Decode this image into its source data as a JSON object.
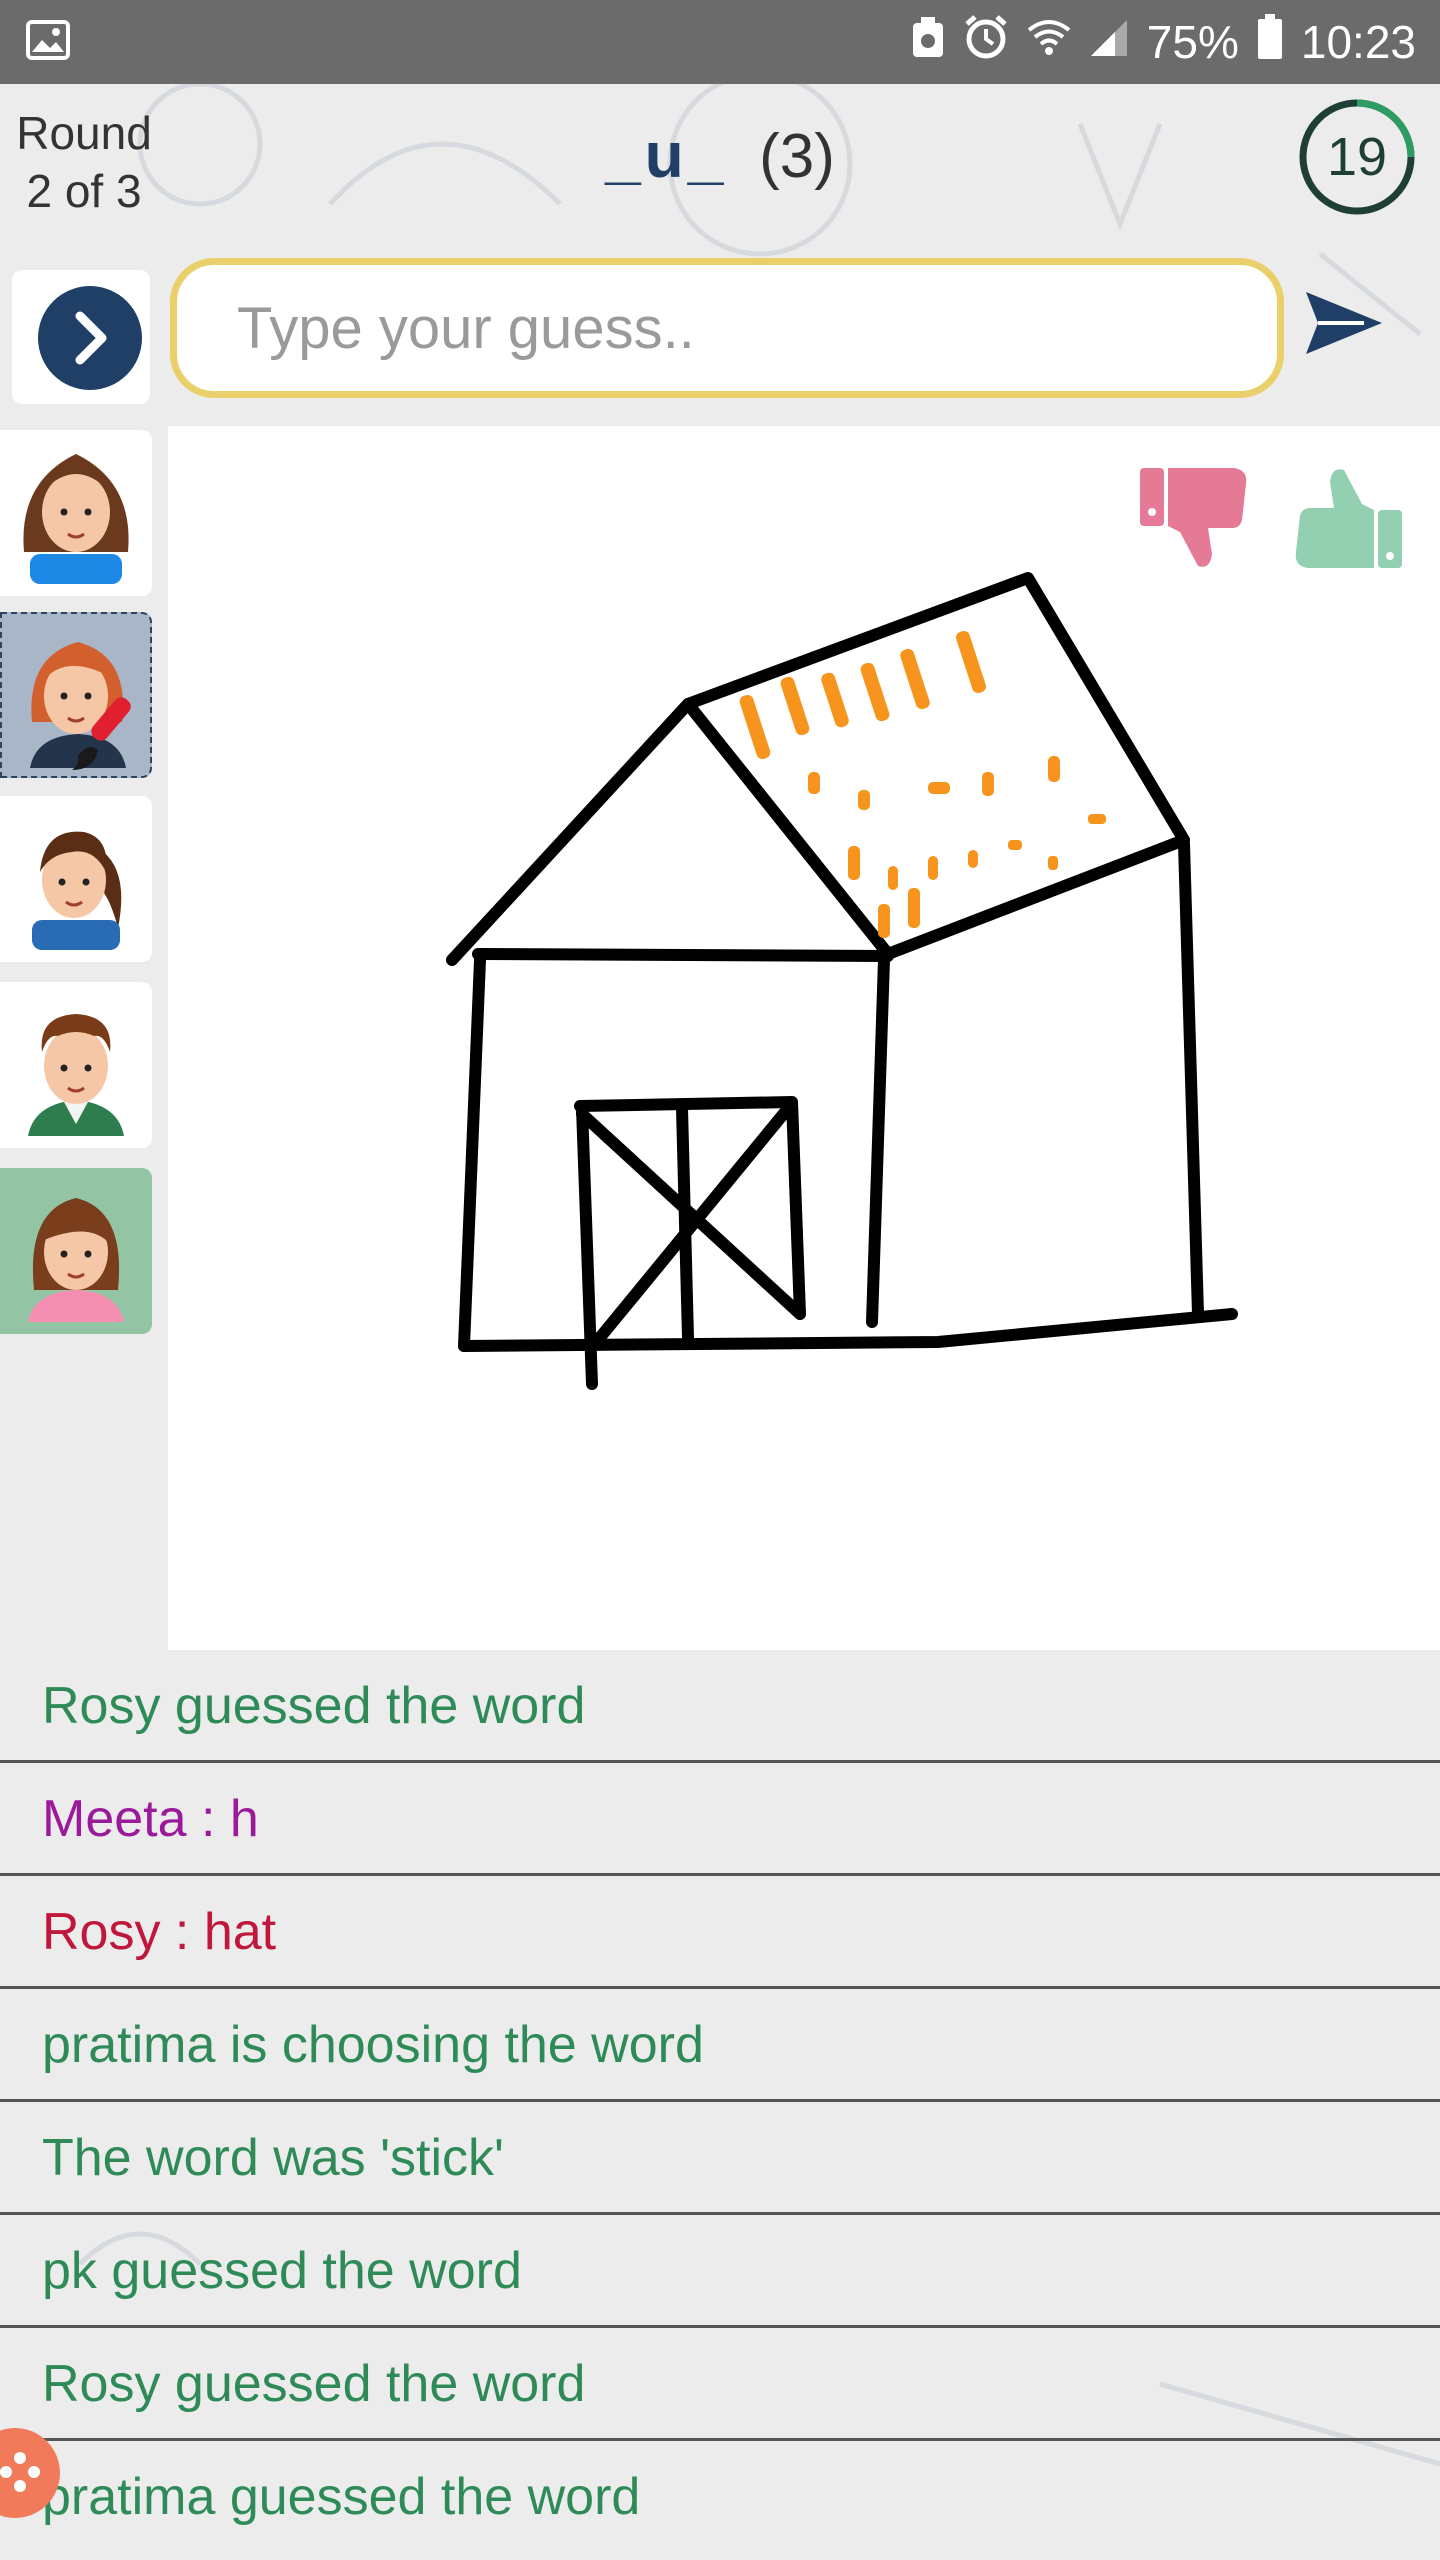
{
  "status_bar": {
    "battery": "75%",
    "time": "10:23"
  },
  "header": {
    "round_line1": "Round",
    "round_line2": "2 of 3",
    "word_hint": "_u_",
    "word_length": "(3)",
    "timer": "19"
  },
  "guess": {
    "placeholder": "Type your guess.."
  },
  "players": [
    {
      "avatar": "woman-curly-hair-avatar",
      "state": "normal"
    },
    {
      "avatar": "woman-red-hair-avatar",
      "state": "drawing"
    },
    {
      "avatar": "girl-ponytail-avatar",
      "state": "normal"
    },
    {
      "avatar": "man-curly-hair-avatar",
      "state": "normal"
    },
    {
      "avatar": "woman-pink-shirt-avatar",
      "state": "guessed"
    }
  ],
  "chat": [
    {
      "text": "Rosy guessed the word",
      "color": "#2e8b57"
    },
    {
      "text": "Meeta : h",
      "color": "#9b1a9b"
    },
    {
      "text": "Rosy : hat",
      "color": "#c0173c"
    },
    {
      "text": "pratima is choosing the word",
      "color": "#2e8b57"
    },
    {
      "text": "The word was 'stick'",
      "color": "#2e8b57"
    },
    {
      "text": "pk guessed the word",
      "color": "#2e8b57"
    },
    {
      "text": "Rosy guessed the word",
      "color": "#2e8b57"
    },
    {
      "text": "pratima guessed the word",
      "color": "#2e8b57"
    }
  ],
  "colors": {
    "accent": "#1f3f66",
    "input_border": "#e9d06a",
    "thumbs_down": "#e57a97",
    "thumbs_up": "#93cfb1",
    "roof_fill": "#f7941d"
  }
}
